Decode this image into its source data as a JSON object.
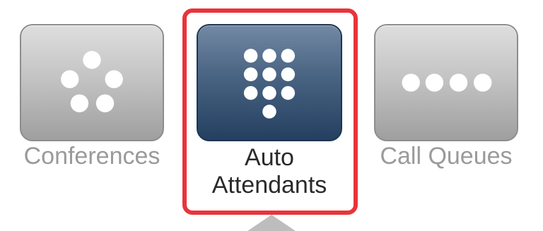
{
  "tiles": [
    {
      "label": "Conferences",
      "icon": "conference-dots-icon",
      "selected": false
    },
    {
      "label": "Auto Attendants",
      "label_line1": "Auto",
      "label_line2": "Attendants",
      "icon": "keypad-icon",
      "selected": true
    },
    {
      "label": "Call Queues",
      "icon": "queue-dots-icon",
      "selected": false
    }
  ],
  "colors": {
    "selection_border": "#e8343a",
    "active_tile": "#3a5474",
    "inactive_tile": "#bdbdbd",
    "inactive_label": "#9a9a9a",
    "active_label": "#2a2a2a"
  }
}
